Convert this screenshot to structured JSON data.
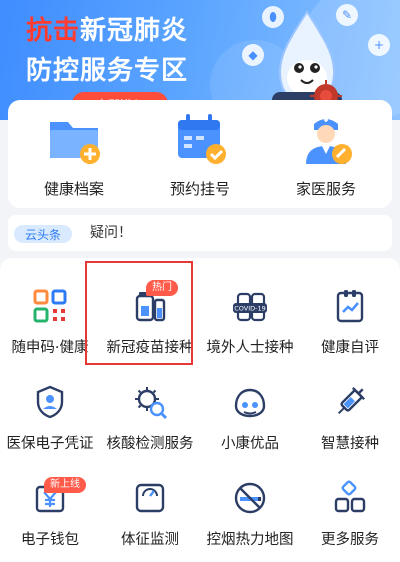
{
  "banner": {
    "title_red": "抗击",
    "title_rest": "新冠肺炎",
    "title_line2": "防控服务专区",
    "pill": "立即进入"
  },
  "quick": [
    {
      "label": "健康档案",
      "icon": "folder-plus-icon"
    },
    {
      "label": "预约挂号",
      "icon": "calendar-check-icon"
    },
    {
      "label": "家医服务",
      "icon": "doctor-icon"
    }
  ],
  "news": {
    "tag": "云头条",
    "text": "疑问！"
  },
  "services": [
    {
      "label": "随申码·健康",
      "icon": "qr-code-icon"
    },
    {
      "label": "新冠疫苗接种",
      "icon": "vaccine-vial-icon",
      "badge": "热门"
    },
    {
      "label": "境外人士接种",
      "icon": "covid19-vaccine-icon"
    },
    {
      "label": "健康自评",
      "icon": "self-assessment-icon"
    },
    {
      "label": "医保电子凭证",
      "icon": "insurance-shield-icon"
    },
    {
      "label": "核酸检测服务",
      "icon": "virus-search-icon"
    },
    {
      "label": "小康优品",
      "icon": "store-bag-icon"
    },
    {
      "label": "智慧接种",
      "icon": "syringe-icon"
    },
    {
      "label": "电子钱包",
      "icon": "wallet-icon",
      "badge": "新上线"
    },
    {
      "label": "体征监测",
      "icon": "scale-icon"
    },
    {
      "label": "控烟热力地图",
      "icon": "no-smoking-icon"
    },
    {
      "label": "更多服务",
      "icon": "more-grid-icon"
    }
  ],
  "colors": {
    "accent": "#2d7cf6",
    "badge": "#ff5a4a",
    "highlight": "#e53935"
  }
}
